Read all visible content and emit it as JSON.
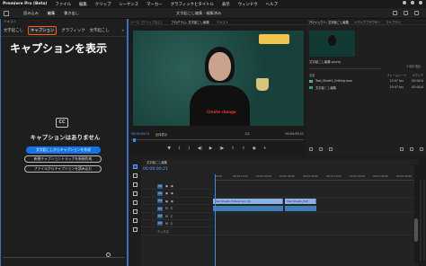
{
  "menubar": {
    "app": "Premiere Pro (Beta)",
    "items": [
      "ファイル",
      "編集",
      "クリップ",
      "シーケンス",
      "マーカー",
      "グラフィックとタイトル",
      "表示",
      "ウィンドウ",
      "ヘルプ"
    ]
  },
  "toolbar": {
    "tabs": [
      "読み込み",
      "編集",
      "書き出し"
    ],
    "active_tab": "編集",
    "project_title": "文字起こし編集 - 編集済み"
  },
  "left_panel": {
    "top_label": "テキスト",
    "tabs": [
      "文字起こし",
      "キャプション",
      "グラフィック",
      "文字起こし"
    ],
    "active_tab": "キャプション",
    "more": "»",
    "title": "キャプションを表示",
    "cc_icon": "CC",
    "empty_message": "キャプションはありません",
    "primary_button": "文字起こしからキャプションを作成",
    "button_new_track": "新規キャプショントラックを新規作成",
    "button_from_file": "ファイルからキャプションを読み込む"
  },
  "monitor": {
    "tabs": [
      "ソース（クリップなし）",
      "プログラム: 文字起こし編集",
      "テキスト"
    ],
    "active_tab": "プログラム: 文字起こし編集",
    "timecode": "00:00:00:21",
    "fit": "全体表示",
    "quality": "1/2",
    "duration": "00:04:59:22",
    "shirt_text": "Create change",
    "transport_icons": [
      "marker-icon",
      "in-point-icon",
      "out-point-icon",
      "step-back-icon",
      "play-icon",
      "step-forward-icon",
      "go-to-out-icon",
      "lift-icon",
      "extract-icon",
      "camera-icon",
      "add-icon"
    ]
  },
  "project": {
    "tabs": [
      "プロジェクト: 文字起こし編集",
      "メディアブラウザー",
      "ライブラリ"
    ],
    "active_tab": "プロジェクト: 文字起こし編集",
    "project_file": "文字起こし編集.prproj",
    "item_count": "2 個の項目",
    "columns": [
      "名前",
      "フレームレート",
      "メディア"
    ],
    "rows": [
      {
        "name": "Test_Sheet1_Editing.mov",
        "fps": "29.97 fps",
        "dur": "00:00:0",
        "color": "#4db38a"
      },
      {
        "name": "文字起こし編集",
        "fps": "29.97 fps",
        "dur": "00:00:0",
        "color": "#39a07a"
      }
    ]
  },
  "timeline": {
    "tab": "文字起こし編集",
    "timecode": "00:00:00:21",
    "ruler": [
      "00:00",
      "00:00:15:00",
      "00:00:30:00",
      "00:00:45:00",
      "00:01:00:00",
      "00:01:15:00",
      "00:01:30:00",
      "00:01:45:00",
      "00:02:00:00"
    ],
    "tracks": [
      {
        "label": "V3",
        "clips": []
      },
      {
        "label": "V2",
        "clips": []
      },
      {
        "label": "V1",
        "clips": [
          {
            "name": "Test_Sheet1_Editing.mov [V]",
            "type": "video"
          },
          {
            "name": "Test_Sheet1_Edit",
            "type": "video"
          }
        ]
      },
      {
        "label": "A1",
        "clips": [
          {
            "name": "",
            "type": "audio"
          },
          {
            "name": "",
            "type": "audio"
          }
        ]
      },
      {
        "label": "A2",
        "clips": []
      },
      {
        "label": "A3",
        "clips": []
      },
      {
        "label": "ミックス",
        "clips": []
      }
    ]
  }
}
